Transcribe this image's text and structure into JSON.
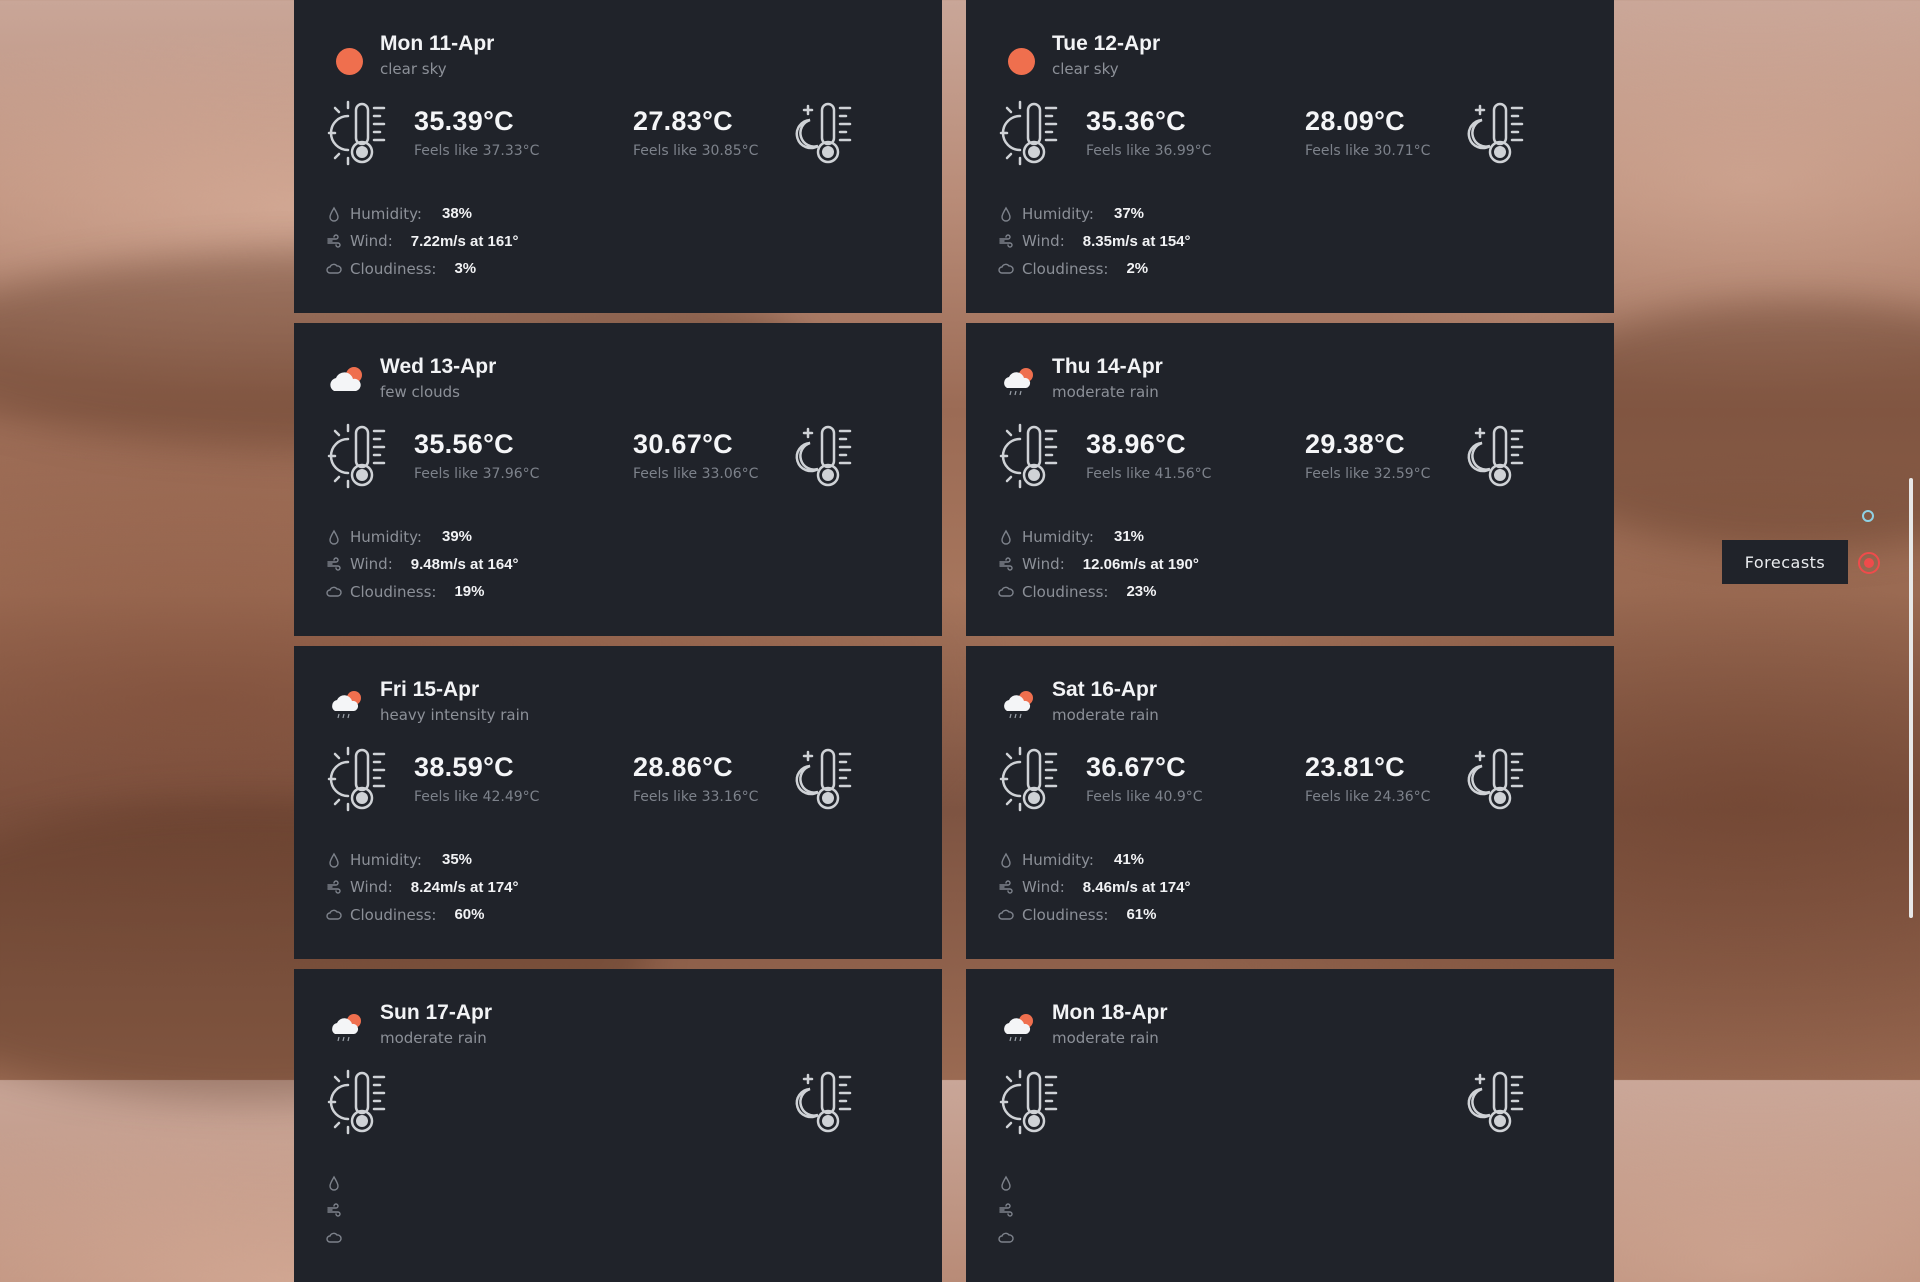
{
  "cards": [
    {
      "day": "Mon 11-Apr",
      "desc": "clear sky",
      "icon": "sun-icon",
      "day_temp": "35.39°C",
      "day_feels": "Feels like 37.33°C",
      "night_temp": "27.83°C",
      "night_feels": "Feels like 30.85°C",
      "humidity": "38%",
      "wind": "7.22m/s at 161°",
      "cloudiness": "3%"
    },
    {
      "day": "Tue 12-Apr",
      "desc": "clear sky",
      "icon": "sun-icon",
      "day_temp": "35.36°C",
      "day_feels": "Feels like 36.99°C",
      "night_temp": "28.09°C",
      "night_feels": "Feels like 30.71°C",
      "humidity": "37%",
      "wind": "8.35m/s at 154°",
      "cloudiness": "2%"
    },
    {
      "day": "Wed 13-Apr",
      "desc": "few clouds",
      "icon": "cloud-sun-icon",
      "day_temp": "35.56°C",
      "day_feels": "Feels like 37.96°C",
      "night_temp": "30.67°C",
      "night_feels": "Feels like 33.06°C",
      "humidity": "39%",
      "wind": "9.48m/s at 164°",
      "cloudiness": "19%"
    },
    {
      "day": "Thu 14-Apr",
      "desc": "moderate rain",
      "icon": "rain-icon",
      "day_temp": "38.96°C",
      "day_feels": "Feels like 41.56°C",
      "night_temp": "29.38°C",
      "night_feels": "Feels like 32.59°C",
      "humidity": "31%",
      "wind": "12.06m/s at 190°",
      "cloudiness": "23%"
    },
    {
      "day": "Fri 15-Apr",
      "desc": "heavy intensity rain",
      "icon": "rain-icon",
      "day_temp": "38.59°C",
      "day_feels": "Feels like 42.49°C",
      "night_temp": "28.86°C",
      "night_feels": "Feels like 33.16°C",
      "humidity": "35%",
      "wind": "8.24m/s at 174°",
      "cloudiness": "60%"
    },
    {
      "day": "Sat 16-Apr",
      "desc": "moderate rain",
      "icon": "rain-icon",
      "day_temp": "36.67°C",
      "day_feels": "Feels like 40.9°C",
      "night_temp": "23.81°C",
      "night_feels": "Feels like 24.36°C",
      "humidity": "41%",
      "wind": "8.46m/s at 174°",
      "cloudiness": "61%"
    },
    {
      "day": "Sun 17-Apr",
      "desc": "moderate rain",
      "icon": "rain-icon"
    },
    {
      "day": "Mon 18-Apr",
      "desc": "moderate rain",
      "icon": "rain-icon"
    }
  ],
  "labels": {
    "humidity": "Humidity:",
    "wind": "Wind:",
    "cloudiness": "Cloudiness:"
  },
  "nav": {
    "label": "Forecasts"
  },
  "colors": {
    "accent": "#ef6f4e",
    "card_bg": "#20232a",
    "active_dot": "#ef4b4b"
  }
}
